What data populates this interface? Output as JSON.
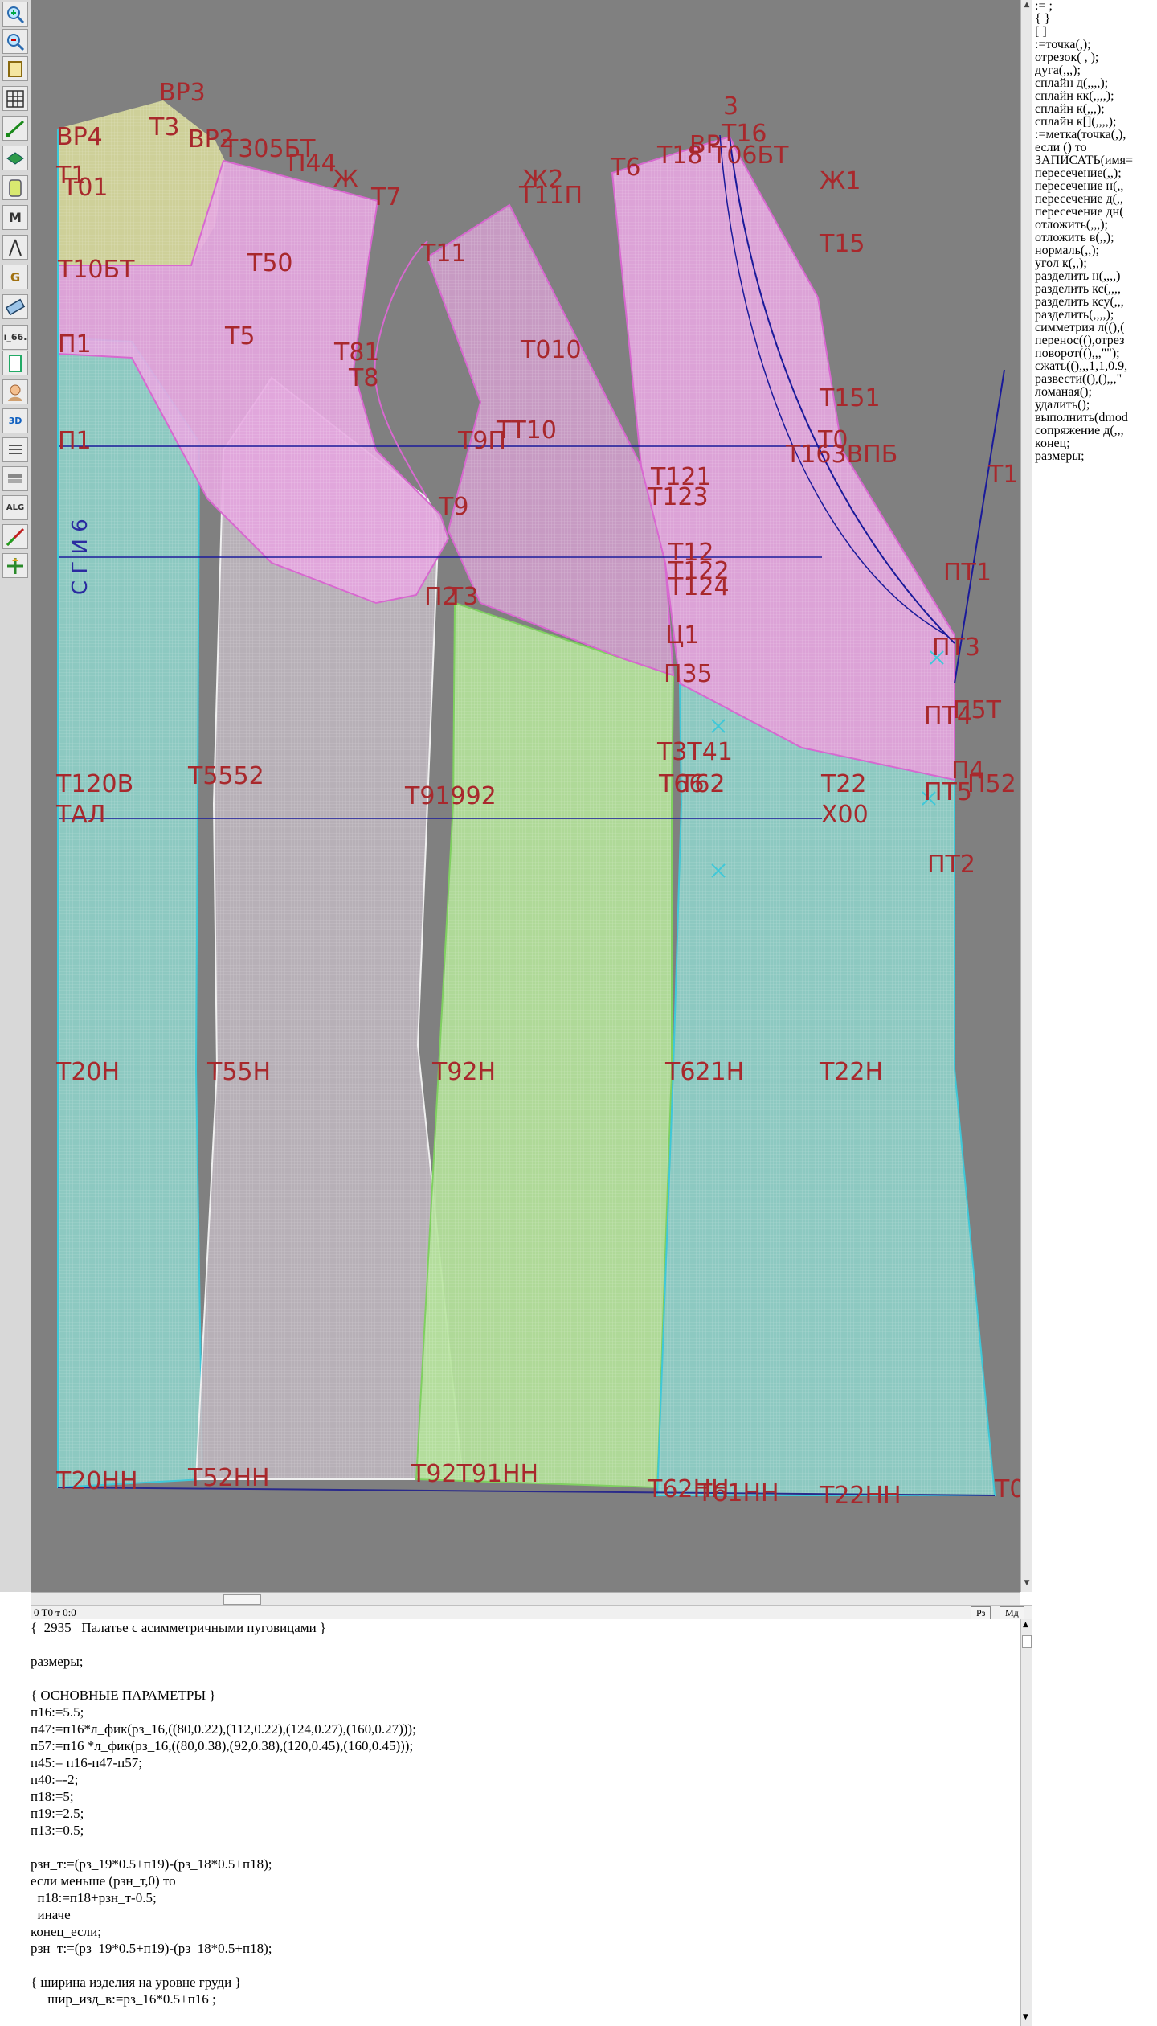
{
  "toolbar": {
    "tools": [
      "zoom-in-icon",
      "zoom-out-icon",
      "page-icon",
      "grid-icon",
      "line-tool-icon",
      "layer-icon",
      "pattern-icon",
      "measure-icon",
      "compass-icon",
      "g-tool-icon",
      "ruler-icon"
    ],
    "label_i66": "i_66.",
    "label_3d": "3D",
    "label_alg": "ALG"
  },
  "canvas": {
    "labels": [
      "ВР3",
      "ВР4",
      "Т3",
      "ВР2",
      "Т305БТ",
      "П44",
      "Ж",
      "Т7",
      "Т1",
      "Т01",
      "Т10БТ",
      "Т50",
      "П1",
      "Т5",
      "Т81",
      "Т8",
      "Т11",
      "Т010",
      "Т9П",
      "ТТ10",
      "П1",
      "Т9",
      "П2",
      "Т3",
      "Ж2",
      "Т11П",
      "Т6",
      "ВР",
      "Т18",
      "Т16",
      "3",
      "Т06БТ",
      "Ж1",
      "Т15",
      "Т151",
      "Т0",
      "Т163ВПБ",
      "Т121",
      "Т123",
      "Т12",
      "Т122",
      "Т124",
      "Ц1",
      "П35",
      "ПТ1",
      "ПТ3",
      "ПТ4",
      "П5Т",
      "ПТ5",
      "П4",
      "П52",
      "ПТ2",
      "Т22",
      "Х00",
      "Т3Т41",
      "Т66",
      "Т62",
      "Т120В",
      "Т5552",
      "Т91992",
      "ТАЛ",
      "Т20Н",
      "Т55Н",
      "Т92Н",
      "Т621Н",
      "Т22Н",
      "Т20НН",
      "Т52НН",
      "Т92Т91НН",
      "Т62НН",
      "Т61НН",
      "Т22НН",
      "Т1",
      "Т0"
    ],
    "side_label": "С Г И 6"
  },
  "cmd_panel": {
    "items": [
      ":= ;",
      "{ }",
      "[ ]",
      ":=точка(,);",
      "отрезок( , );",
      "дуга(,,,);",
      "сплайн д(,,,,);",
      "сплайн кк(,,,,);",
      "сплайн к(,,,);",
      "сплайн к[](,,,,);",
      ":=метка(точка(,),",
      "если () то",
      "ЗАПИСАТЬ(имя=",
      "пересечение(,,);",
      "пересечение н(,,",
      "пересечение д(,,",
      "пересечение дн(",
      "отложить(,,,);",
      "отложить в(,,);",
      "нормаль(,,);",
      "угол к(,,);",
      "разделить н(,,,,)",
      "разделить кс(,,,,",
      "разделить ксу(,,,",
      "разделить(,,,,);",
      "симметрия л((),(",
      "перенос((),отрез",
      "поворот((),,,\"\");",
      "сжать((),,,1,1,0.9,",
      "развести((),(),,,\"",
      "ломаная();",
      "удалить();",
      "выполнить(dmod",
      "сопряжение д(,,,",
      "конец;",
      "размеры;"
    ]
  },
  "status": {
    "coords": "0  T0 т 0:0",
    "btn_pz": "Рз",
    "btn_md": "Мд"
  },
  "editor": {
    "lines": [
      "{  2935   Палатье с асимметричными пуговицами }",
      "",
      "размеры;",
      "",
      "{ ОСНОВНЫЕ ПАРАМЕТРЫ }",
      "п16:=5.5;",
      "п47:=п16*л_фик(рз_16,((80,0.22),(112,0.22),(124,0.27),(160,0.27)));",
      "п57:=п16 *л_фик(рз_16,((80,0.38),(92,0.38),(120,0.45),(160,0.45)));",
      "п45:= п16-п47-п57;",
      "п40:=-2;",
      "п18:=5;",
      "п19:=2.5;",
      "п13:=0.5;",
      "",
      "рзн_т:=(рз_19*0.5+п19)-(рз_18*0.5+п18);",
      "если меньше (рзн_т,0) то",
      "  п18:=п18+рзн_т-0.5;",
      "  иначе",
      "конец_если;",
      "рзн_т:=(рз_19*0.5+п19)-(рз_18*0.5+п18);",
      "",
      "{ ширина изделия на уровне груди }",
      "     шир_изд_в:=рз_16*0.5+п16 ;"
    ]
  },
  "colors": {
    "canvas_bg": "#808080",
    "label_red": "#a8282c",
    "fill_cyan": "#8fd6cc",
    "fill_pink": "#e6a6e0",
    "fill_green": "#b4e29a",
    "fill_yellow": "#d2d49a",
    "fill_grey": "#b8b0b8"
  }
}
